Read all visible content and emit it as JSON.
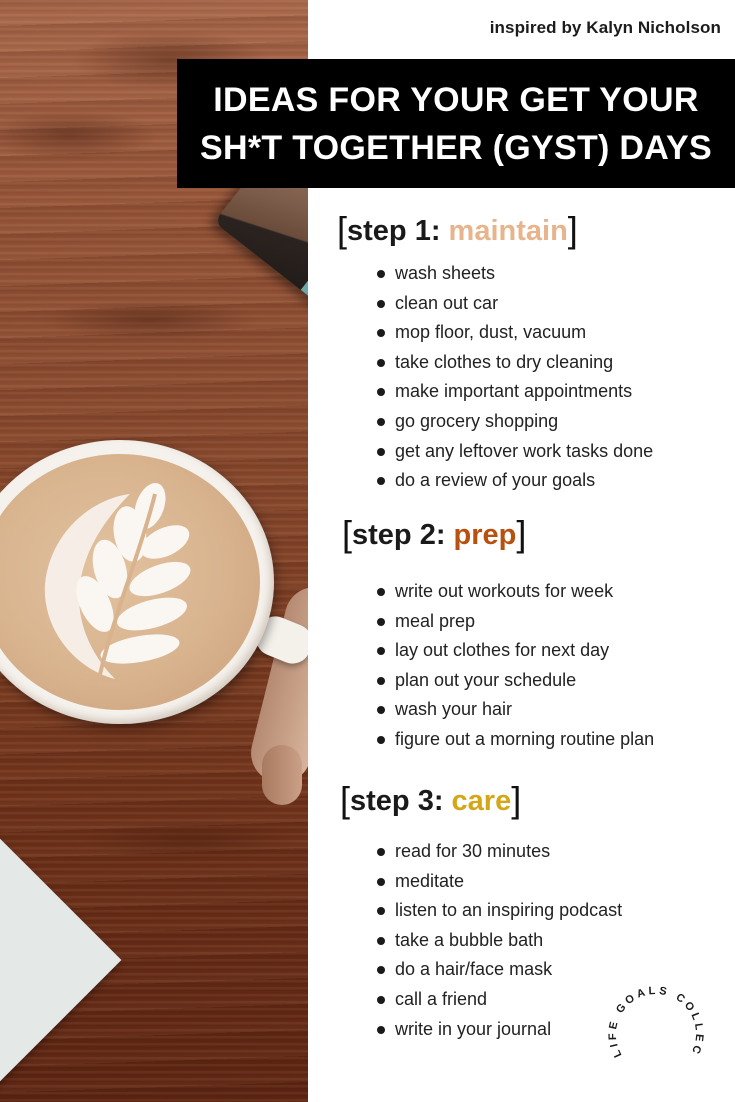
{
  "credit": "inspired by Kalyn Nicholson",
  "banner": {
    "line1": "IDEAS FOR YOUR GET YOUR",
    "line2": "SH*T TOGETHER (GYST) DAYS"
  },
  "colors": {
    "maintain": "#e8b48c",
    "prep": "#b8500f",
    "care": "#d4a718",
    "banner_bg": "#000000",
    "text": "#1c1c1c"
  },
  "sections": [
    {
      "open_bracket": "[",
      "prefix": "step 1: ",
      "keyword": "maintain",
      "close_bracket": "]",
      "items": [
        "wash sheets",
        "clean out car",
        "mop floor, dust, vacuum",
        "take clothes to dry cleaning",
        "make important appointments",
        "go grocery shopping",
        "get any leftover work tasks done",
        "do a review of your goals"
      ]
    },
    {
      "open_bracket": "[",
      "prefix": "step 2: ",
      "keyword": "prep",
      "close_bracket": "]",
      "items": [
        "write out workouts for week",
        "meal prep",
        "lay out clothes for next day",
        "plan out your schedule",
        "wash your hair",
        "figure out a morning routine plan"
      ]
    },
    {
      "open_bracket": "[",
      "prefix": "step 3: ",
      "keyword": "care",
      "close_bracket": "]",
      "items": [
        "read for 30 minutes",
        "meditate",
        "listen to an inspiring podcast",
        "take a bubble bath",
        "do a hair/face mask",
        "call a friend",
        "write in your journal"
      ]
    }
  ],
  "logo": {
    "text": "LIFE GOALS COLLECTIVE"
  },
  "photo": {
    "icon": "coffee-latte-photo"
  }
}
